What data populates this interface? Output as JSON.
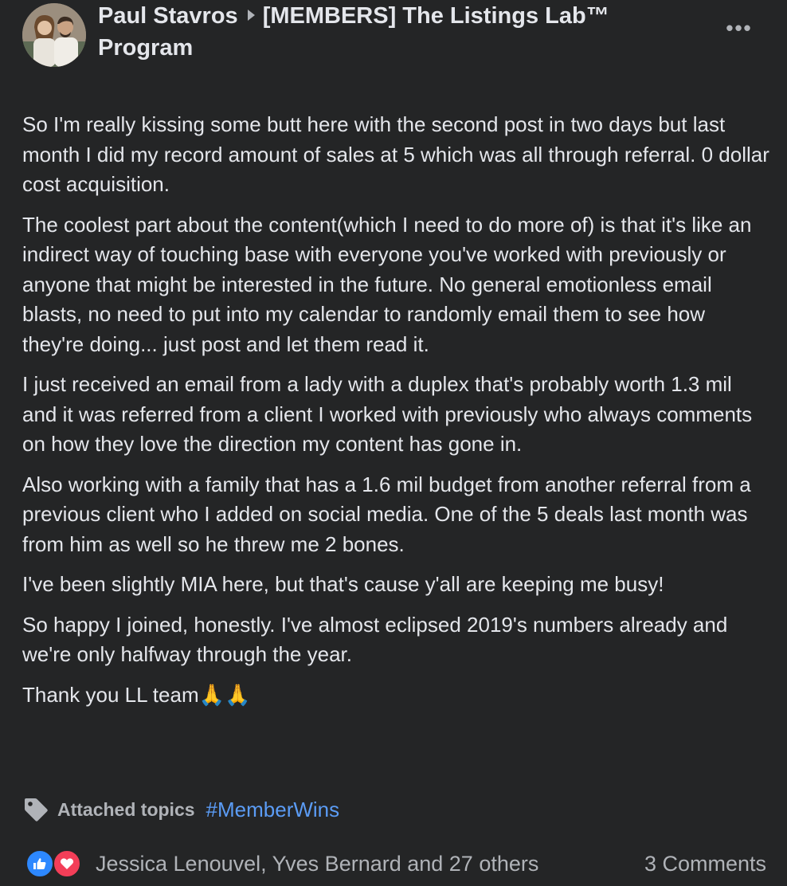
{
  "header": {
    "author": "Paul Stavros",
    "group": "[MEMBERS] The Listings Lab™ Program",
    "more_icon": "more-horizontal-icon"
  },
  "post": {
    "paragraphs": [
      "So I'm really kissing some butt here with the second post in two days but last month I did my record amount of sales at 5 which was all through referral.  0 dollar cost acquisition.",
      "The coolest part about the content(which I need to do more of) is that it's like an indirect way of touching base with everyone you've worked with previously or anyone that might be interested in the future.  No general emotionless email blasts, no need to put into my calendar to randomly email them to see how they're doing... just post and let them read it.",
      "I just received an email from a lady with a duplex that's probably worth 1.3 mil and it was referred from a client I worked with previously who always comments on how they love the direction my content has gone in.",
      "Also working with a family that has a 1.6 mil budget from another referral from a previous client who I added on social media.  One of the 5 deals last month was from him as well so he threw me 2 bones.",
      "I've been slightly MIA here, but that's cause y'all are keeping me busy!",
      "So happy I joined, honestly.  I've almost eclipsed 2019's numbers already and we're only halfway through the year.",
      "Thank you LL team🙏🙏"
    ]
  },
  "topics": {
    "icon": "tag-icon",
    "label": "Attached topics",
    "hashtag": "#MemberWins"
  },
  "footer": {
    "reaction_icons": [
      "like-icon",
      "love-icon"
    ],
    "reactors": "Jessica Lenouvel, Yves Bernard and 27 others",
    "comments": "3 Comments"
  },
  "colors": {
    "background": "#242526",
    "text_primary": "#e4e6eb",
    "text_secondary": "#b0b3b8",
    "link": "#5b9cf5",
    "like": "#2d88ff",
    "love": "#f33e58"
  }
}
